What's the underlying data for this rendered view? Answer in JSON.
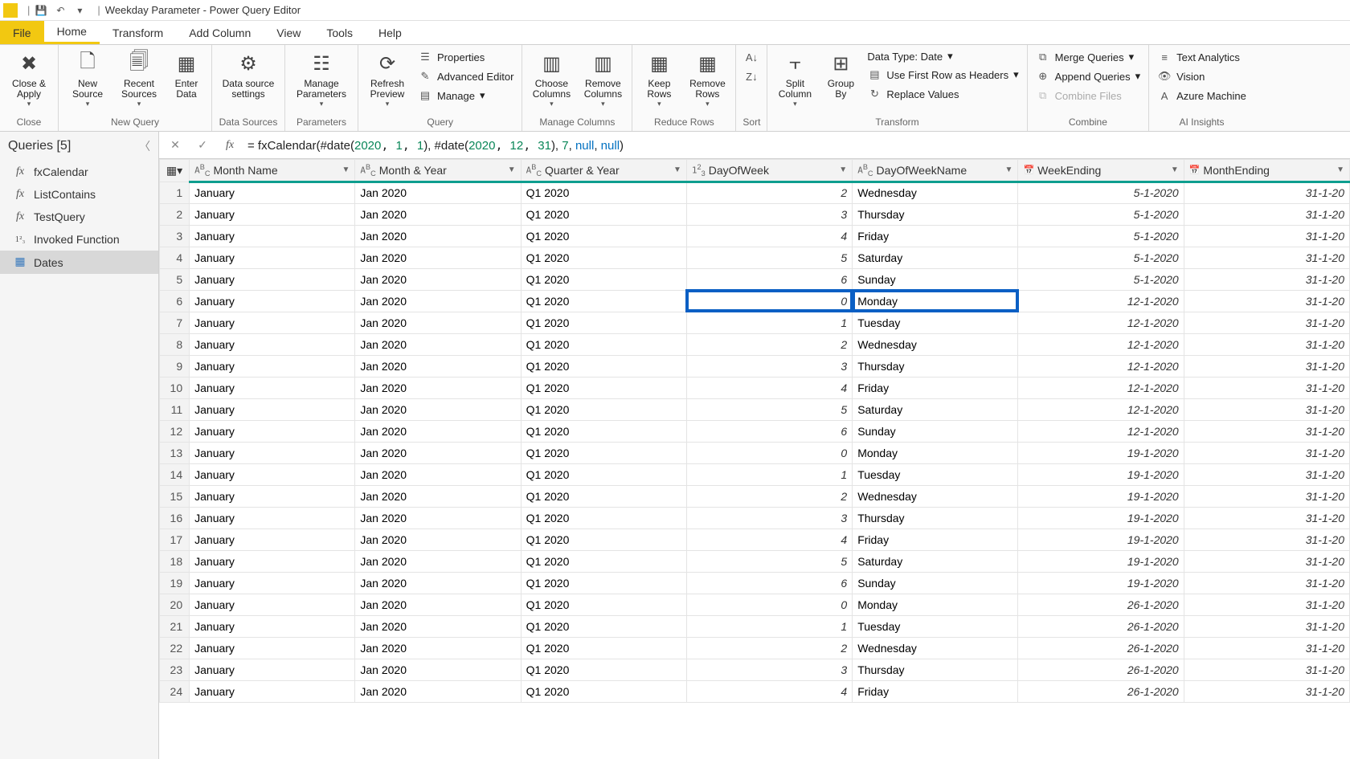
{
  "title": "Weekday Parameter - Power Query Editor",
  "menutabs": {
    "file": "File",
    "home": "Home",
    "transform": "Transform",
    "addcolumn": "Add Column",
    "view": "View",
    "tools": "Tools",
    "help": "Help"
  },
  "ribbon": {
    "close": {
      "closeapply": "Close &\nApply",
      "group": "Close"
    },
    "newquery": {
      "newsource": "New\nSource",
      "recentsources": "Recent\nSources",
      "enterdata": "Enter\nData",
      "group": "New Query"
    },
    "datasources": {
      "dssettings": "Data source\nsettings",
      "group": "Data Sources"
    },
    "parameters": {
      "manageparams": "Manage\nParameters",
      "group": "Parameters"
    },
    "query": {
      "refresh": "Refresh\nPreview",
      "properties": "Properties",
      "adveditor": "Advanced Editor",
      "manage": "Manage",
      "group": "Query"
    },
    "managecols": {
      "choosecols": "Choose\nColumns",
      "removecols": "Remove\nColumns",
      "group": "Manage Columns"
    },
    "reducerows": {
      "keeprows": "Keep\nRows",
      "removerows": "Remove\nRows",
      "group": "Reduce Rows"
    },
    "sort": {
      "group": "Sort"
    },
    "transform": {
      "splitcol": "Split\nColumn",
      "groupby": "Group\nBy",
      "datatype": "Data Type: Date",
      "firstrow": "Use First Row as Headers",
      "replacevals": "Replace Values",
      "group": "Transform"
    },
    "combine": {
      "merge": "Merge Queries",
      "append": "Append Queries",
      "combinefiles": "Combine Files",
      "group": "Combine"
    },
    "ai": {
      "textanalytics": "Text Analytics",
      "vision": "Vision",
      "azureml": "Azure Machine",
      "group": "AI Insights"
    }
  },
  "sidebar": {
    "header": "Queries [5]",
    "items": [
      {
        "name": "fxCalendar",
        "kind": "fx"
      },
      {
        "name": "ListContains",
        "kind": "fx"
      },
      {
        "name": "TestQuery",
        "kind": "fx"
      },
      {
        "name": "Invoked Function",
        "kind": "param"
      },
      {
        "name": "Dates",
        "kind": "table",
        "selected": true
      }
    ]
  },
  "formula": {
    "prefix": "= fxCalendar(#date(",
    "a1": "2020",
    "a2": "1",
    "a3": "1",
    "mid": "), #date(",
    "b1": "2020",
    "b2": "12",
    "b3": "31",
    "suffix1": "), ",
    "c1": "7",
    "suffix2": ", ",
    "n1": "null",
    "suffix3": ", ",
    "n2": "null",
    "end": ")"
  },
  "columns": [
    {
      "key": "monthname",
      "label": "Month Name",
      "type": "ABC"
    },
    {
      "key": "monthyear",
      "label": "Month & Year",
      "type": "ABC"
    },
    {
      "key": "qy",
      "label": "Quarter & Year",
      "type": "ABC"
    },
    {
      "key": "dow",
      "label": "DayOfWeek",
      "type": "123"
    },
    {
      "key": "down",
      "label": "DayOfWeekName",
      "type": "ABC"
    },
    {
      "key": "weekending",
      "label": "WeekEnding",
      "type": "DATE"
    },
    {
      "key": "monthending",
      "label": "MonthEnding",
      "type": "DATE"
    }
  ],
  "rows": [
    {
      "n": 1,
      "monthname": "January",
      "monthyear": "Jan 2020",
      "qy": "Q1 2020",
      "dow": 2,
      "down": "Wednesday",
      "weekending": "5-1-2020",
      "monthending": "31-1-20"
    },
    {
      "n": 2,
      "monthname": "January",
      "monthyear": "Jan 2020",
      "qy": "Q1 2020",
      "dow": 3,
      "down": "Thursday",
      "weekending": "5-1-2020",
      "monthending": "31-1-20"
    },
    {
      "n": 3,
      "monthname": "January",
      "monthyear": "Jan 2020",
      "qy": "Q1 2020",
      "dow": 4,
      "down": "Friday",
      "weekending": "5-1-2020",
      "monthending": "31-1-20"
    },
    {
      "n": 4,
      "monthname": "January",
      "monthyear": "Jan 2020",
      "qy": "Q1 2020",
      "dow": 5,
      "down": "Saturday",
      "weekending": "5-1-2020",
      "monthending": "31-1-20"
    },
    {
      "n": 5,
      "monthname": "January",
      "monthyear": "Jan 2020",
      "qy": "Q1 2020",
      "dow": 6,
      "down": "Sunday",
      "weekending": "5-1-2020",
      "monthending": "31-1-20"
    },
    {
      "n": 6,
      "monthname": "January",
      "monthyear": "Jan 2020",
      "qy": "Q1 2020",
      "dow": 0,
      "down": "Monday",
      "weekending": "12-1-2020",
      "monthending": "31-1-20",
      "highlight": true
    },
    {
      "n": 7,
      "monthname": "January",
      "monthyear": "Jan 2020",
      "qy": "Q1 2020",
      "dow": 1,
      "down": "Tuesday",
      "weekending": "12-1-2020",
      "monthending": "31-1-20"
    },
    {
      "n": 8,
      "monthname": "January",
      "monthyear": "Jan 2020",
      "qy": "Q1 2020",
      "dow": 2,
      "down": "Wednesday",
      "weekending": "12-1-2020",
      "monthending": "31-1-20"
    },
    {
      "n": 9,
      "monthname": "January",
      "monthyear": "Jan 2020",
      "qy": "Q1 2020",
      "dow": 3,
      "down": "Thursday",
      "weekending": "12-1-2020",
      "monthending": "31-1-20"
    },
    {
      "n": 10,
      "monthname": "January",
      "monthyear": "Jan 2020",
      "qy": "Q1 2020",
      "dow": 4,
      "down": "Friday",
      "weekending": "12-1-2020",
      "monthending": "31-1-20"
    },
    {
      "n": 11,
      "monthname": "January",
      "monthyear": "Jan 2020",
      "qy": "Q1 2020",
      "dow": 5,
      "down": "Saturday",
      "weekending": "12-1-2020",
      "monthending": "31-1-20"
    },
    {
      "n": 12,
      "monthname": "January",
      "monthyear": "Jan 2020",
      "qy": "Q1 2020",
      "dow": 6,
      "down": "Sunday",
      "weekending": "12-1-2020",
      "monthending": "31-1-20"
    },
    {
      "n": 13,
      "monthname": "January",
      "monthyear": "Jan 2020",
      "qy": "Q1 2020",
      "dow": 0,
      "down": "Monday",
      "weekending": "19-1-2020",
      "monthending": "31-1-20"
    },
    {
      "n": 14,
      "monthname": "January",
      "monthyear": "Jan 2020",
      "qy": "Q1 2020",
      "dow": 1,
      "down": "Tuesday",
      "weekending": "19-1-2020",
      "monthending": "31-1-20"
    },
    {
      "n": 15,
      "monthname": "January",
      "monthyear": "Jan 2020",
      "qy": "Q1 2020",
      "dow": 2,
      "down": "Wednesday",
      "weekending": "19-1-2020",
      "monthending": "31-1-20"
    },
    {
      "n": 16,
      "monthname": "January",
      "monthyear": "Jan 2020",
      "qy": "Q1 2020",
      "dow": 3,
      "down": "Thursday",
      "weekending": "19-1-2020",
      "monthending": "31-1-20"
    },
    {
      "n": 17,
      "monthname": "January",
      "monthyear": "Jan 2020",
      "qy": "Q1 2020",
      "dow": 4,
      "down": "Friday",
      "weekending": "19-1-2020",
      "monthending": "31-1-20"
    },
    {
      "n": 18,
      "monthname": "January",
      "monthyear": "Jan 2020",
      "qy": "Q1 2020",
      "dow": 5,
      "down": "Saturday",
      "weekending": "19-1-2020",
      "monthending": "31-1-20"
    },
    {
      "n": 19,
      "monthname": "January",
      "monthyear": "Jan 2020",
      "qy": "Q1 2020",
      "dow": 6,
      "down": "Sunday",
      "weekending": "19-1-2020",
      "monthending": "31-1-20"
    },
    {
      "n": 20,
      "monthname": "January",
      "monthyear": "Jan 2020",
      "qy": "Q1 2020",
      "dow": 0,
      "down": "Monday",
      "weekending": "26-1-2020",
      "monthending": "31-1-20"
    },
    {
      "n": 21,
      "monthname": "January",
      "monthyear": "Jan 2020",
      "qy": "Q1 2020",
      "dow": 1,
      "down": "Tuesday",
      "weekending": "26-1-2020",
      "monthending": "31-1-20"
    },
    {
      "n": 22,
      "monthname": "January",
      "monthyear": "Jan 2020",
      "qy": "Q1 2020",
      "dow": 2,
      "down": "Wednesday",
      "weekending": "26-1-2020",
      "monthending": "31-1-20"
    },
    {
      "n": 23,
      "monthname": "January",
      "monthyear": "Jan 2020",
      "qy": "Q1 2020",
      "dow": 3,
      "down": "Thursday",
      "weekending": "26-1-2020",
      "monthending": "31-1-20"
    },
    {
      "n": 24,
      "monthname": "January",
      "monthyear": "Jan 2020",
      "qy": "Q1 2020",
      "dow": 4,
      "down": "Friday",
      "weekending": "26-1-2020",
      "monthending": "31-1-20"
    }
  ]
}
